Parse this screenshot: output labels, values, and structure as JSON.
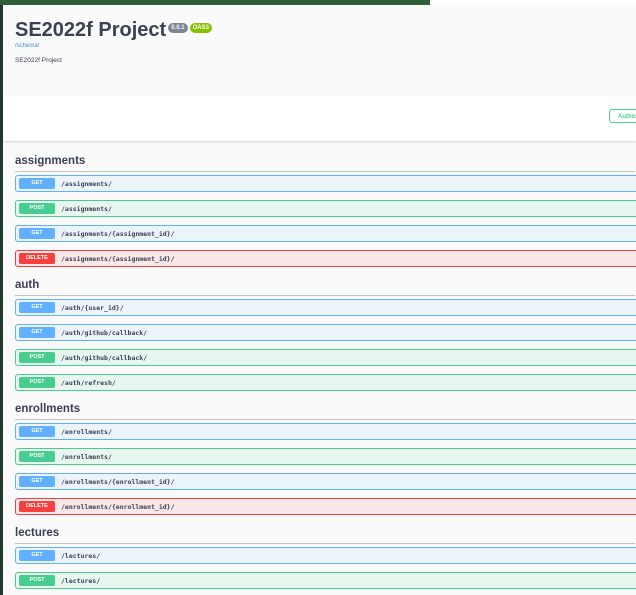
{
  "info": {
    "title": "SE2022f Project",
    "version_badge": "0.0.1",
    "oas_badge": "OAS3",
    "schema_link": "/schema/",
    "description": "SE2022f Project"
  },
  "auth_button_label": "Authorize",
  "tags": [
    {
      "name": "assignments",
      "operations": [
        {
          "method": "GET",
          "path": "/assignments/"
        },
        {
          "method": "POST",
          "path": "/assignments/"
        },
        {
          "method": "GET",
          "path": "/assignments/{assignment_id}/"
        },
        {
          "method": "DELETE",
          "path": "/assignments/{assignment_id}/"
        }
      ]
    },
    {
      "name": "auth",
      "operations": [
        {
          "method": "GET",
          "path": "/auth/{user_id}/"
        },
        {
          "method": "GET",
          "path": "/auth/github/callback/"
        },
        {
          "method": "POST",
          "path": "/auth/github/callback/"
        },
        {
          "method": "POST",
          "path": "/auth/refresh/"
        }
      ]
    },
    {
      "name": "enrollments",
      "operations": [
        {
          "method": "GET",
          "path": "/enrollments/"
        },
        {
          "method": "POST",
          "path": "/enrollments/"
        },
        {
          "method": "GET",
          "path": "/enrollments/{enrollment_id}/"
        },
        {
          "method": "DELETE",
          "path": "/enrollments/{enrollment_id}/"
        }
      ]
    },
    {
      "name": "lectures",
      "operations": [
        {
          "method": "GET",
          "path": "/lectures/"
        },
        {
          "method": "POST",
          "path": "/lectures/"
        }
      ]
    }
  ]
}
